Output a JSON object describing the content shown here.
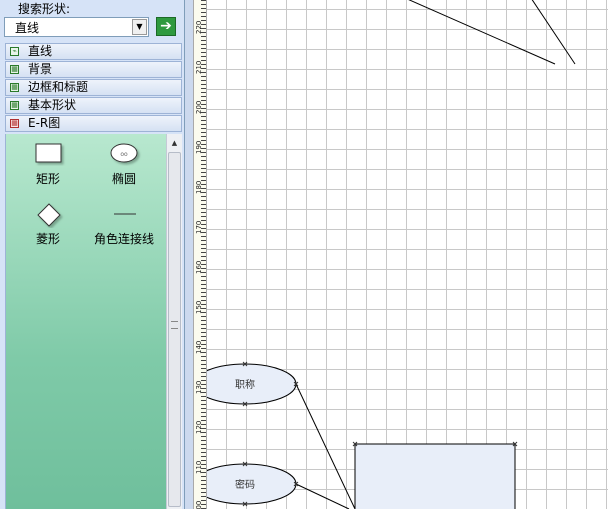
{
  "shapes_panel": {
    "search_label": "搜索形状:",
    "search_value": "直线",
    "stencils": [
      {
        "label": "直线"
      },
      {
        "label": "背景"
      },
      {
        "label": "边框和标题"
      },
      {
        "label": "基本形状"
      },
      {
        "label": "E-R图"
      }
    ],
    "shapes": [
      {
        "label": "矩形",
        "icon": "rectangle-icon"
      },
      {
        "label": "椭圆",
        "icon": "ellipse-icon"
      },
      {
        "label": "菱形",
        "icon": "diamond-icon"
      },
      {
        "label": "角色连接线",
        "icon": "connector-line-icon"
      }
    ]
  },
  "ruler": {
    "labels": [
      "220",
      "210",
      "200",
      "190",
      "180",
      "170",
      "160",
      "150",
      "140",
      "130",
      "120",
      "110",
      "100"
    ]
  },
  "drawing": {
    "attributes": [
      {
        "label": "职称"
      },
      {
        "label": "密码"
      }
    ]
  }
}
